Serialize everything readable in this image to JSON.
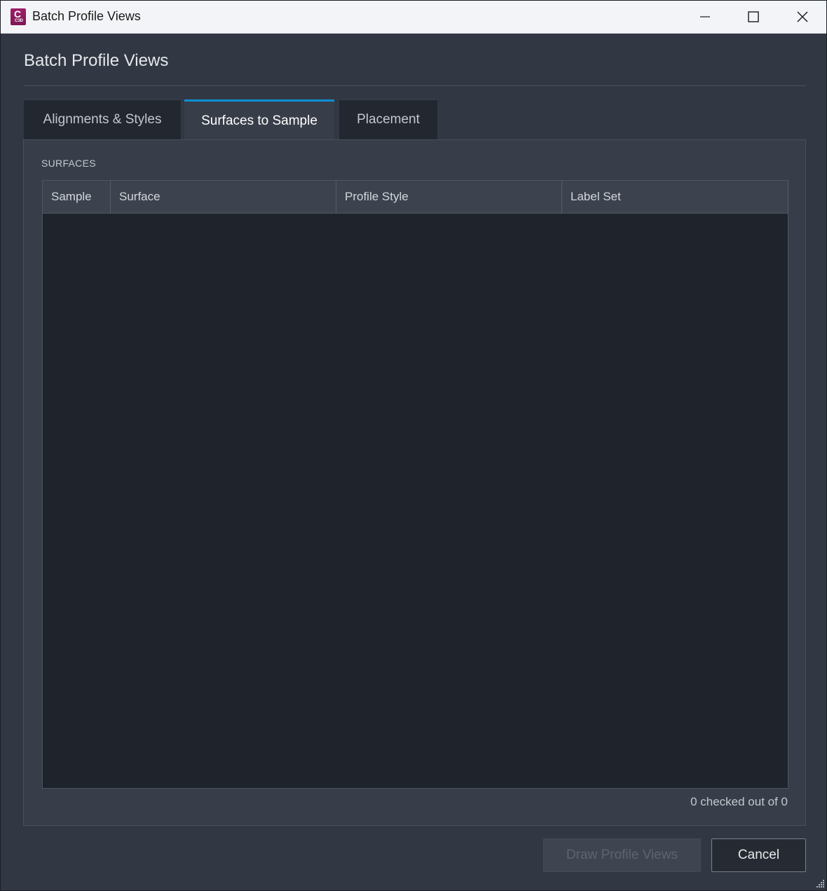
{
  "window": {
    "title": "Batch Profile Views",
    "app_icon": {
      "letter": "C",
      "sub": "C3D"
    }
  },
  "heading": "Batch Profile Views",
  "tabs": [
    {
      "label": "Alignments & Styles",
      "active": false
    },
    {
      "label": "Surfaces to Sample",
      "active": true
    },
    {
      "label": "Placement",
      "active": false
    }
  ],
  "surfaces": {
    "section_label": "SURFACES",
    "columns": [
      "Sample",
      "Surface",
      "Profile Style",
      "Label Set"
    ],
    "rows": [],
    "count_text": "0 checked out of 0"
  },
  "buttons": {
    "draw_label": "Draw Profile Views",
    "draw_enabled": false,
    "cancel_label": "Cancel"
  },
  "icons": {
    "minimize": "minimize-icon",
    "maximize": "maximize-icon",
    "close": "close-icon",
    "grip": "resize-grip-icon"
  },
  "colors": {
    "accent": "#0e8fd6",
    "background": "#323843",
    "grid_background": "#1f232b"
  }
}
